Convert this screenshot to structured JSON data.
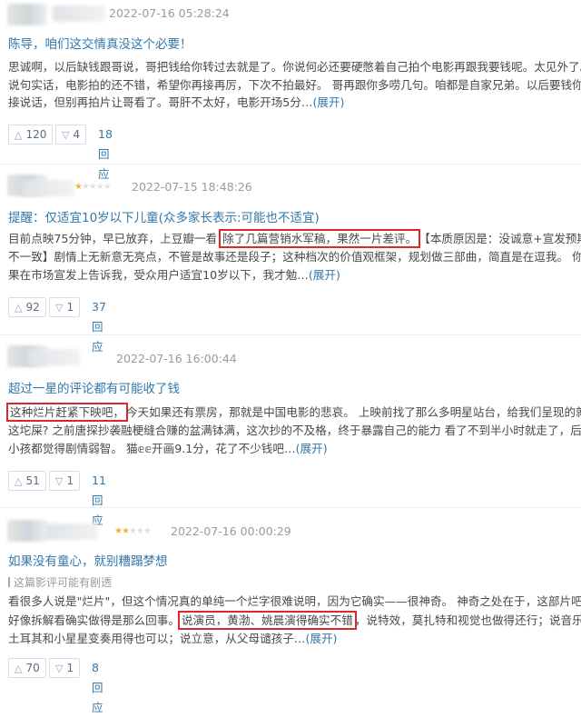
{
  "reviews": [
    {
      "stars": 0,
      "time": "2022-07-16 05:28:24",
      "title": "陈导，咱们这交情真没这个必要！",
      "lines": [
        "思诚啊，以后缺钱跟哥说，哥把钱给你转过去就是了。你说何必还要硬憋着自己拍个电影再跟我要钱呢。太见外了。",
        "说句实话，电影拍的还不错，希望你再接再厉，下次不拍最好。 哥再跟你多唠几句。咱都是自家兄弟。以后要钱你直",
        "接说话，但别再拍片让哥看了。哥肝不太好，电影开场5分…"
      ],
      "expand": "(展开)",
      "useful": "120",
      "useless": "4",
      "replies": "18回应"
    },
    {
      "stars": 1,
      "time": "2022-07-15 18:48:26",
      "title": "提醒：仅适宜10岁以下儿童(众多家长表示:可能也不适宜)",
      "line1_pre": "目前点映75分钟，早已放弃，上豆瓣一看 ",
      "line1_hl": "除了几篇营销水军稿，果然一片差评。",
      "line1_post": "【本质原因是：没诚意+宣发预期",
      "lines": [
        "不一致】剧情上无新意无亮点，不管是故事还是段子；这种档次的价值观框架，规划做三部曲，简直是在逗我。 你如",
        "果在市场宣发上告诉我，受众用户适宜10岁以下，我才勉…"
      ],
      "expand": "(展开)",
      "useful": "92",
      "useless": "1",
      "replies": "37回应"
    },
    {
      "stars": 0,
      "time": "2022-07-16 16:00:44",
      "title": "超过一星的评论都有可能收了钱",
      "line1_hl": "这种烂片赶紧下映吧，",
      "line1_post": "今天如果还有票房，那就是中国电影的悲哀。 上映前找了那么多明星站台，给我们呈现的就是",
      "lines": [
        "这坨屎? 之前唐探抄袭融梗缝合赚的盆满钵满，这次抄的不及格，终于暴露自己的能力 看了不到半小时就走了，后排",
        "小孩都觉得剧情弱智。 猫𝕖𝕖开画9.1分，花了不少钱吧…"
      ],
      "expand": "(展开)",
      "useful": "51",
      "useless": "1",
      "replies": "11回应"
    },
    {
      "stars": 2,
      "time": "2022-07-16 00:00:29",
      "title": "如果没有童心，就别糟蹋梦想",
      "spoiler": "这篇影评可能有剧透",
      "line1": "看很多人说是\"烂片\"，但这个情况真的单纯一个烂字很难说明，因为它确实——很神奇。 神奇之处在于，这部片吧，",
      "line2_pre": "好像拆解看确实做得是那么回事。",
      "line2_hl": "说演员，黄渤、姚晨演得确实不错",
      "line2_post": "，说特效，莫扎特和视觉也做得还行；说音乐，",
      "line3": "土耳其和小星星变奏用得也可以；说立意，从父母谴孩子…",
      "expand": "(展开)",
      "useful": "70",
      "useless": "1",
      "replies": "8回应"
    }
  ],
  "icons": {
    "useful": "thumbs-up-icon",
    "useless": "thumbs-down-icon"
  },
  "colors": {
    "link": "#3377aa",
    "highlight_box": "#e0252b",
    "star": "#f4b23a"
  }
}
